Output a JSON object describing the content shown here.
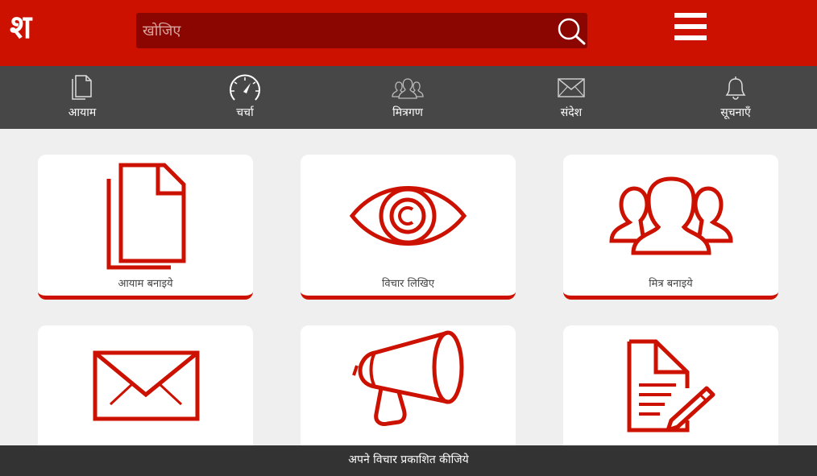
{
  "header": {
    "logo": "श",
    "search": {
      "placeholder": "खोजिए",
      "value": ""
    }
  },
  "nav": {
    "items": [
      {
        "label": "आयाम",
        "icon": "documents-icon"
      },
      {
        "label": "चर्चा",
        "icon": "speedometer-icon"
      },
      {
        "label": "मित्रगण",
        "icon": "people-icon"
      },
      {
        "label": "संदेश",
        "icon": "envelope-icon"
      },
      {
        "label": "सूचनाएँ",
        "icon": "bell-icon"
      }
    ]
  },
  "cards": [
    {
      "label": "आयाम बनाइये",
      "icon": "documents-icon"
    },
    {
      "label": "विचार लिखिए",
      "icon": "eye-icon"
    },
    {
      "label": "मित्र बनाइये",
      "icon": "people-icon"
    },
    {
      "label": "",
      "icon": "envelope-icon"
    },
    {
      "label": "",
      "icon": "megaphone-icon"
    },
    {
      "label": "",
      "icon": "document-edit-icon"
    }
  ],
  "footer": {
    "text": "अपने विचार प्रकाशित कीजिये"
  },
  "colors": {
    "brand_red": "#cc1100",
    "search_bg": "#8b0600",
    "nav_bg": "#474747",
    "footer_bg": "#333333",
    "page_bg": "#efefef"
  }
}
